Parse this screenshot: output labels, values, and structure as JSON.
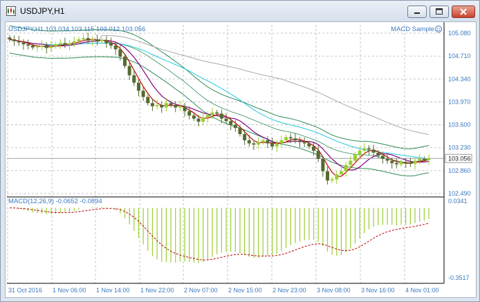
{
  "window": {
    "title": "USDJPY,H1",
    "buttons": {
      "minimize": "minimize",
      "maximize": "maximize",
      "close": "close"
    }
  },
  "main_chart": {
    "info": "USDJPY,H1  103.034 103.115 103.012 103.056",
    "expert_label": "MACD Sample",
    "price_labels": [
      "105.080",
      "104.710",
      "104.340",
      "103.970",
      "103.600",
      "103.230",
      "102.860",
      "102.490"
    ],
    "current_price_label": "103.056",
    "bid_line_value": 103.056
  },
  "indicator": {
    "label": "MACD(12,26,9) -0.0652 -0.0894",
    "scale_labels": [
      "0.0341",
      "-0.3517"
    ]
  },
  "time_labels": [
    "31 Oct 2016",
    "1 Nov 06:00",
    "1 Nov 14:00",
    "1 Nov 22:00",
    "2 Nov 07:00",
    "2 Nov 15:00",
    "2 Nov 23:00",
    "3 Nov 08:00",
    "3 Nov 16:00",
    "4 Nov 01:00"
  ],
  "colors": {
    "up_candle": "#9acd32",
    "down_candle": "#556b2f",
    "text": "#3a78bf",
    "grid": "#b4b4b4",
    "bid_line": "#a0a0a0",
    "ma_fast": "#c00000",
    "ma_slow": "#800080",
    "ma_cyan": "#22c8e0",
    "ma_gray": "#a8a8a8",
    "bands": "#2e8b57",
    "macd_hist": "#9acd32",
    "macd_signal": "#c00000"
  },
  "chart_data": {
    "type": "candlestick",
    "symbol": "USDJPY",
    "timeframe": "H1",
    "last_bar": {
      "open": 103.034,
      "high": 103.115,
      "low": 103.012,
      "close": 103.056
    },
    "price_range": [
      102.49,
      105.08
    ],
    "closes": [
      104.98,
      104.95,
      104.93,
      104.9,
      104.88,
      104.85,
      104.86,
      104.88,
      104.84,
      104.87,
      104.9,
      104.92,
      104.89,
      104.92,
      104.95,
      104.98,
      105.0,
      104.96,
      104.98,
      104.95,
      104.97,
      104.92,
      104.88,
      104.82,
      104.7,
      104.55,
      104.4,
      104.28,
      104.15,
      104.05,
      103.95,
      103.9,
      103.92,
      103.88,
      103.95,
      103.92,
      103.88,
      103.9,
      103.82,
      103.75,
      103.7,
      103.65,
      103.72,
      103.76,
      103.8,
      103.78,
      103.7,
      103.66,
      103.6,
      103.55,
      103.45,
      103.35,
      103.3,
      103.28,
      103.32,
      103.35,
      103.3,
      103.25,
      103.3,
      103.35,
      103.4,
      103.38,
      103.35,
      103.32,
      103.3,
      103.25,
      103.18,
      103.05,
      102.85,
      102.7,
      102.72,
      102.8,
      102.85,
      102.95,
      103.02,
      103.12,
      103.18,
      103.22,
      103.2,
      103.15,
      103.1,
      103.05,
      103.02,
      102.98,
      102.96,
      103.0,
      102.98,
      102.97,
      103.02,
      103.05,
      103.03,
      103.06
    ],
    "macd": {
      "name": "MACD(12,26,9)",
      "main": -0.0652,
      "signal": -0.0894,
      "axis_range": [
        -0.3517,
        0.0341
      ]
    }
  }
}
